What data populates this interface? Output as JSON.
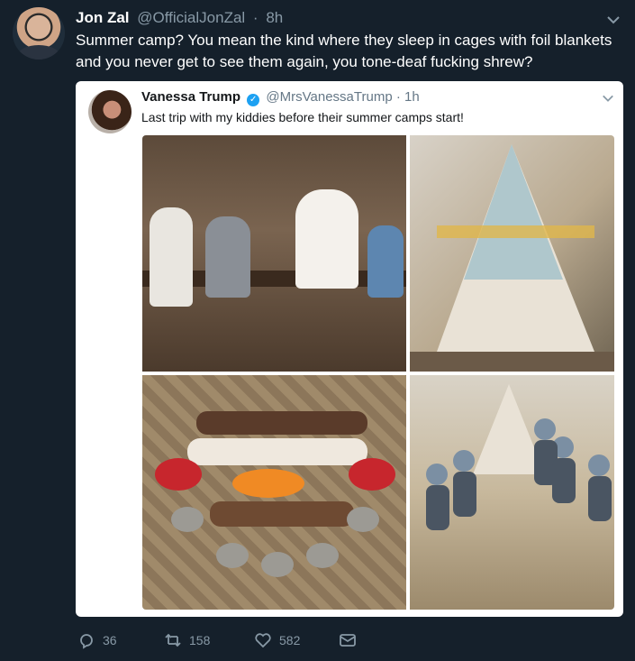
{
  "tweet": {
    "author_name": "Jon Zal",
    "author_handle": "@OfficialJonZal",
    "separator": "·",
    "time": "8h",
    "text": "Summer camp? You mean the kind where they sleep in cages with foil blankets and you never get to see them again, you tone-deaf fucking shrew?"
  },
  "quoted": {
    "author_name": "Vanessa Trump",
    "author_handle": "@MrsVanessaTrump",
    "separator": "·",
    "time": "1h",
    "text": "Last trip with my kiddies before their summer camps start!",
    "verified_icon": "check"
  },
  "actions": {
    "reply_count": "36",
    "retweet_count": "158",
    "like_count": "582"
  },
  "colors": {
    "background": "#15202b",
    "muted": "#8899a6",
    "verified": "#1da1f2"
  }
}
